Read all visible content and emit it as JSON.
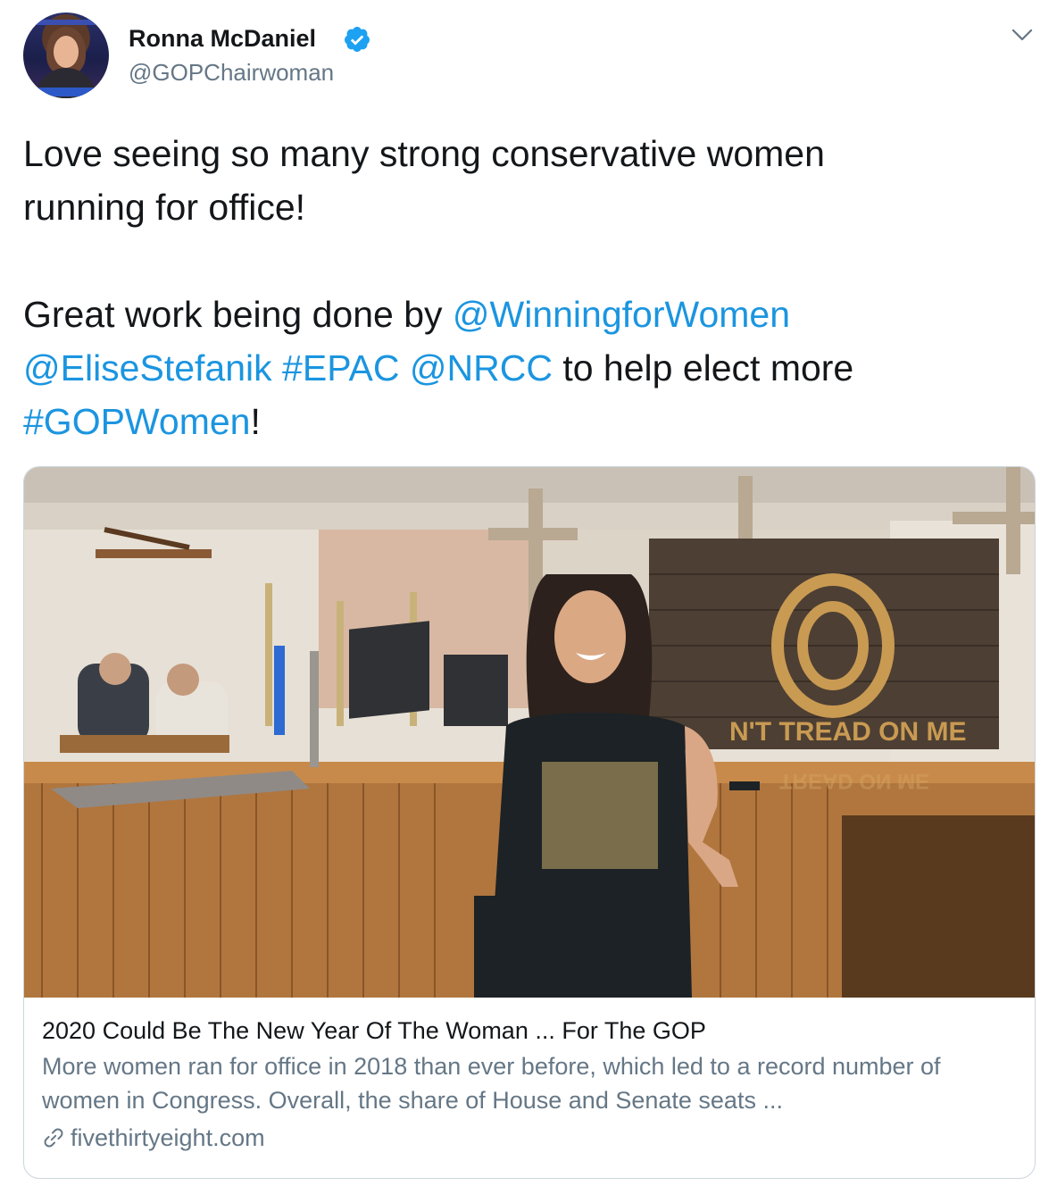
{
  "author": {
    "display_name": "Ronna McDaniel",
    "handle": "@GOPChairwoman",
    "verified": true,
    "avatar_icon": "profile-photo"
  },
  "tweet": {
    "line1": "Love seeing so many strong conservative women",
    "line2": "running for office!",
    "line3_prefix": "Great work being done by ",
    "mention_winning": "@WinningforWomen",
    "mention_elise": "@EliseStefanik",
    "hashtag_epac": "#EPAC",
    "mention_nrcc": "@NRCC",
    "line4_suffix": " to help elect more",
    "hashtag_gopwomen": "#GOPWomen",
    "line5_suffix": "!"
  },
  "card": {
    "title": "2020 Could Be The New Year Of The Woman ... For The GOP",
    "description": "More women ran for office in 2018 than ever before, which led to a record number of women in Congress. Overall, the share of House and Senate seats ...",
    "domain": "fivethirtyeight.com",
    "image_sign_text": "N'T TREAD ON ME",
    "image_sign_reflection": "TREAD ON ME"
  },
  "colors": {
    "link": "#1b95e0",
    "text": "#14171a",
    "secondary": "#657786",
    "border": "#ccd6dd",
    "verified": "#1da1f2"
  }
}
